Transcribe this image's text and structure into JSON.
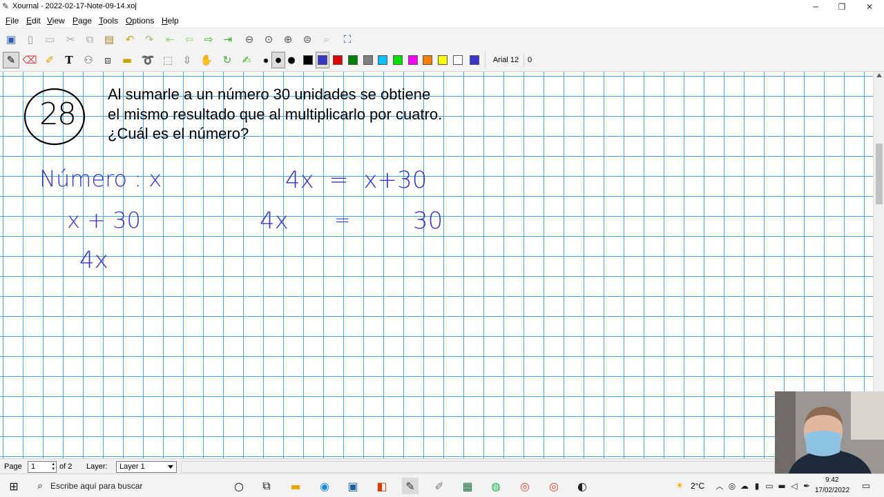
{
  "window": {
    "title": "Xournal - 2022-02-17-Note-09-14.xoj",
    "minimize": "─",
    "maximize": "❐",
    "close": "✕"
  },
  "menu": [
    "File",
    "Edit",
    "View",
    "Page",
    "Tools",
    "Options",
    "Help"
  ],
  "toolbar": {
    "font_name": "Arial 12",
    "font_num": "0",
    "colors": [
      "#000000",
      "#3a37c8",
      "#e00000",
      "#008000",
      "#808080",
      "#00c0ff",
      "#00e000",
      "#ff00ff",
      "#ff8000",
      "#ffff00",
      "#ffffff",
      "#3a37c8"
    ]
  },
  "canvas": {
    "problem_number": "28",
    "problem_lines": [
      "Al sumarle a un número 30 unidades se obtiene",
      "el mismo resultado que al multiplicarlo por cuatro.",
      "¿Cuál es el número?"
    ],
    "handwriting": {
      "variable_def": "Número : x",
      "expr1": "x + 30",
      "expr2": "4x",
      "eq1": "4x  =  x+30",
      "eq2_left": "4x",
      "eq2_mid": "=",
      "eq2_right": "30"
    }
  },
  "status": {
    "page_label": "Page",
    "page_value": "1",
    "page_of": "of 2",
    "layer_label": "Layer:",
    "layer_value": "Layer 1"
  },
  "taskbar": {
    "search_placeholder": "Escribe aquí para buscar",
    "weather": "2°C",
    "time": "9:42",
    "date": "17/02/2022"
  }
}
